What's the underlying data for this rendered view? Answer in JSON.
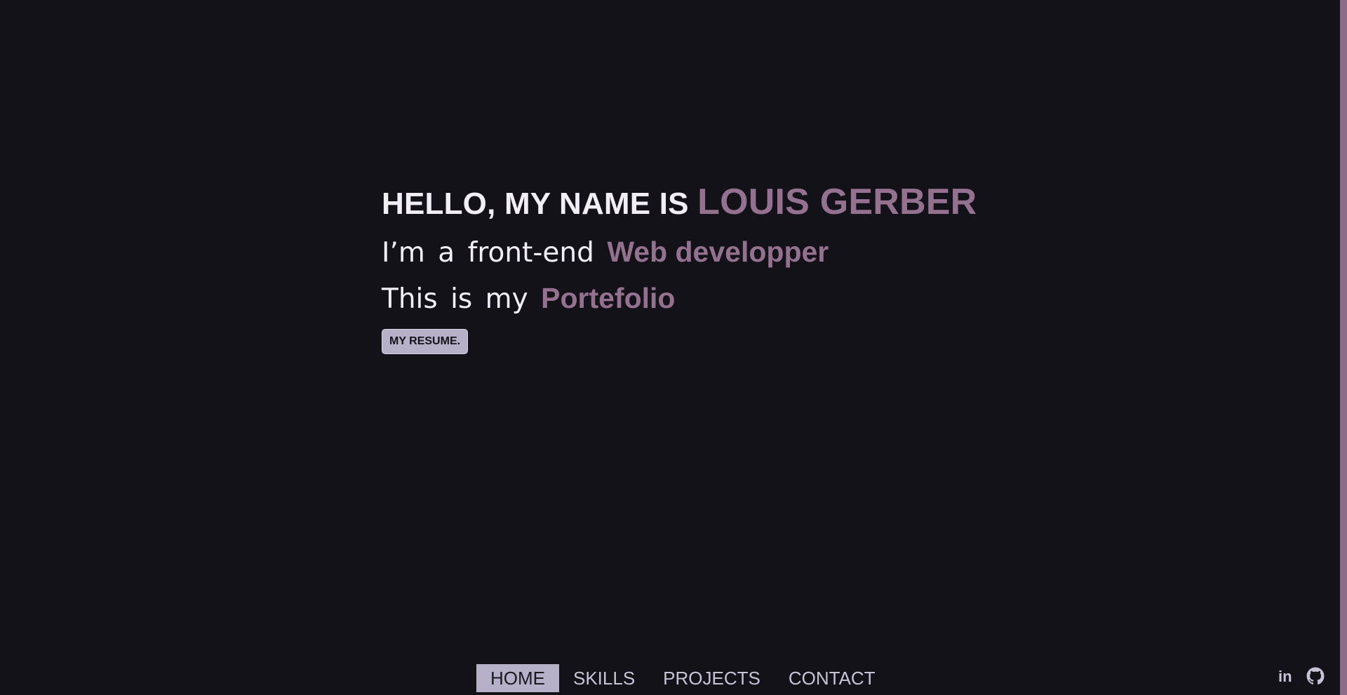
{
  "hero": {
    "title_prefix": "HELLO, MY NAME IS ",
    "name": "LOUIS GERBER",
    "line1_prefix": "I’m a front-end ",
    "line1_highlight": "Web developper",
    "line2_prefix": "This is my ",
    "line2_highlight": "Portefolio",
    "resume_label": "MY RESUME."
  },
  "nav": {
    "items": [
      {
        "label": "HOME",
        "active": true
      },
      {
        "label": "SKILLS",
        "active": false
      },
      {
        "label": "PROJECTS",
        "active": false
      },
      {
        "label": "CONTACT",
        "active": false
      }
    ]
  },
  "social": {
    "linkedin_label": "in",
    "github_icon": "github-icon"
  },
  "colors": {
    "background": "#131218",
    "accent": "#94718F",
    "text": "#F1EEF6",
    "button_bg": "#B6B0C8",
    "scrollbar": "#8C6C8A"
  }
}
